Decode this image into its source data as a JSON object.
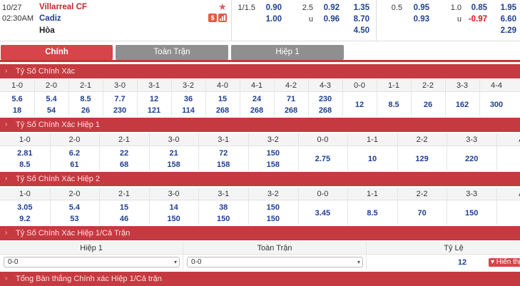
{
  "match": {
    "date": "10/27",
    "time": "02:30AM",
    "home": "Villarreal CF",
    "away": "Cadiz",
    "draw": "Hòa",
    "h_line1": "1/1.5",
    "h_home": "0.90",
    "h_away": "1.00",
    "ou_line": "2.5",
    "ou_over": "0.92",
    "ou_u": "u",
    "ou_under": "0.96",
    "x_home": "1.35",
    "x_away": "8.70",
    "x_draw": "4.50",
    "fh_h_line": "0.5",
    "fh_h_home": "0.95",
    "fh_h_away": "0.93",
    "fh_ou_line": "1.0",
    "fh_ou_over": "0.85",
    "fh_ou_u": "u",
    "fh_ou_under": "-0.97",
    "fh_x_home": "1.95",
    "fh_x_away": "6.60",
    "fh_x_draw": "2.29",
    "badge_s": "$",
    "accent": "#c43a40"
  },
  "tabs": [
    "Chính",
    "Toàn Trận",
    "Hiệp 1"
  ],
  "sections": {
    "s1": {
      "title": "Tỷ Số Chính Xác",
      "headers": [
        "1-0",
        "2-0",
        "2-1",
        "3-0",
        "3-1",
        "3-2",
        "4-0",
        "4-1",
        "4-2",
        "4-3",
        "0-0",
        "1-1",
        "2-2",
        "3-3",
        "4-4"
      ],
      "row1": [
        "5.6",
        "5.4",
        "8.5",
        "7.7",
        "12",
        "36",
        "15",
        "24",
        "71",
        "230",
        "",
        "",
        "",
        "",
        ""
      ],
      "row2": [
        "18",
        "54",
        "26",
        "230",
        "121",
        "114",
        "268",
        "268",
        "268",
        "268",
        "12",
        "8.5",
        "26",
        "162",
        "300"
      ]
    },
    "s2": {
      "title": "Tỷ Số Chính Xác Hiệp 1",
      "headers": [
        "1-0",
        "2-0",
        "2-1",
        "3-0",
        "3-1",
        "3-2",
        "0-0",
        "1-1",
        "2-2",
        "3-3",
        "A"
      ],
      "row1": [
        "2.81",
        "6.2",
        "22",
        "21",
        "72",
        "150",
        "",
        "",
        "",
        "",
        ""
      ],
      "row2": [
        "8.5",
        "61",
        "68",
        "158",
        "158",
        "158",
        "2.75",
        "10",
        "129",
        "220",
        ""
      ]
    },
    "s3": {
      "title": "Tỷ Số Chính Xác Hiệp 2",
      "headers": [
        "1-0",
        "2-0",
        "2-1",
        "3-0",
        "3-1",
        "3-2",
        "0-0",
        "1-1",
        "2-2",
        "3-3",
        "A"
      ],
      "row1": [
        "3.05",
        "5.4",
        "15",
        "14",
        "38",
        "150",
        "",
        "",
        "",
        "",
        ""
      ],
      "row2": [
        "9.2",
        "53",
        "46",
        "150",
        "150",
        "150",
        "3.45",
        "8.5",
        "70",
        "150",
        ""
      ]
    },
    "s4": {
      "title": "Tỷ Số Chính Xác Hiệp 1/Cả Trận",
      "headers": [
        "Hiệp 1",
        "Toàn Trận",
        "Tỷ Lệ"
      ],
      "sel1": "0-0",
      "sel2": "0-0",
      "rate": "12",
      "show": "▾ Hiển thị"
    },
    "s5": {
      "title": "Tổng Bàn thắng Chính xác Hiệp 1/Cả trận"
    }
  }
}
